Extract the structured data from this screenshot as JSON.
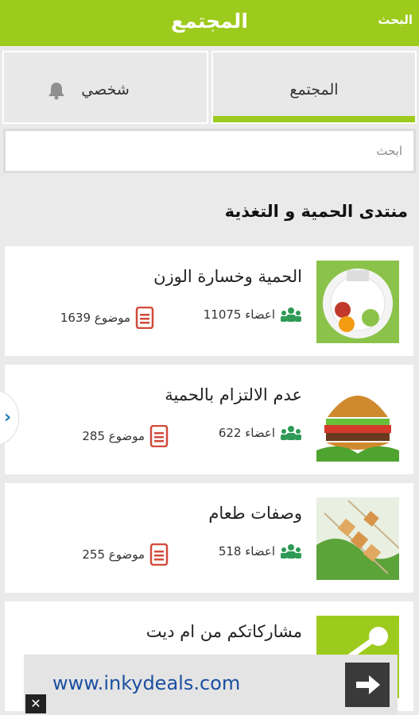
{
  "header": {
    "title": "المجتمع",
    "search_label": "البحث"
  },
  "tabs": [
    {
      "label": "شخصي",
      "icon": "bell-icon"
    },
    {
      "label": "المجتمع"
    }
  ],
  "search": {
    "placeholder": "ابحث"
  },
  "section": {
    "title": "منتدى الحمية و التغذية"
  },
  "forums": [
    {
      "title": "الحمية وخسارة الوزن",
      "members": "11075 اعضاء",
      "topics": "1639 موضوع"
    },
    {
      "title": "عدم الالتزام بالحمية",
      "members": "622 اعضاء",
      "topics": "285 موضوع"
    },
    {
      "title": "وصفات طعام",
      "members": "518 اعضاء",
      "topics": "255 موضوع"
    },
    {
      "title": "مشاركاتكم من ام ديت"
    }
  ],
  "ad": {
    "text": "www.inkydeals.com",
    "close": "✕"
  },
  "colors": {
    "accent": "#9dcb1d",
    "doc": "#d24a3a",
    "people": "#2e9a55"
  }
}
